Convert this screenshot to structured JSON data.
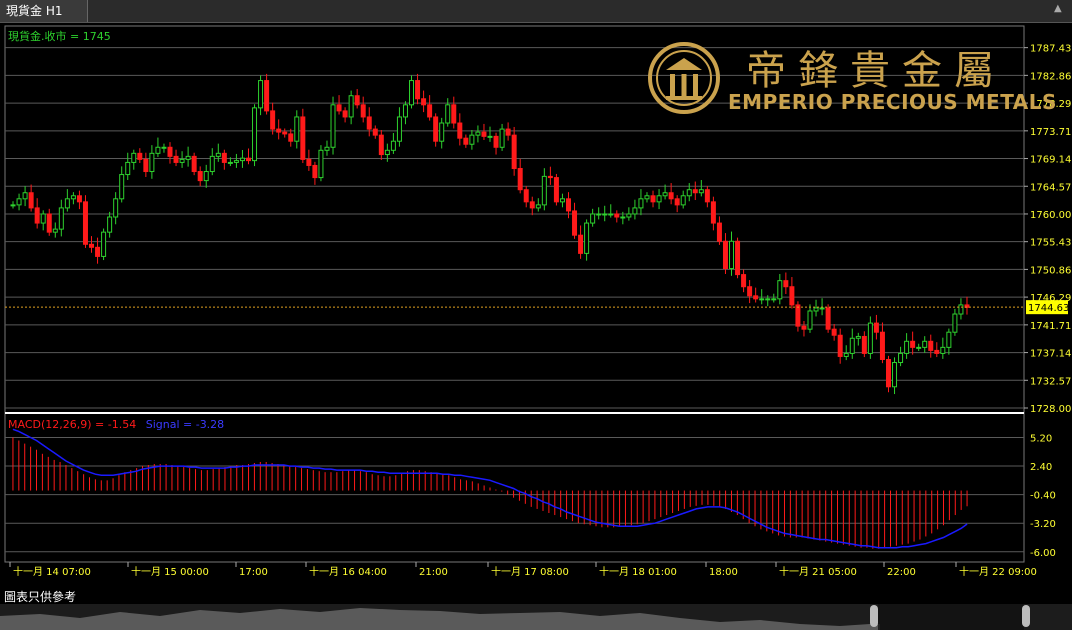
{
  "tab": {
    "label": "現貨金 H1"
  },
  "price_pane": {
    "legend": "現貨金.收市 = 1745"
  },
  "macd_pane": {
    "legend_macd": "MACD(12,26,9) = -1.54",
    "legend_signal": "Signal = -3.28"
  },
  "logo": {
    "chinese": "帝鋒貴金屬",
    "english": "EMPERIO PRECIOUS METALS"
  },
  "footer": {
    "note": "圖表只供參考"
  },
  "colors": {
    "up": "#2ed12e",
    "down": "#ff1a1a",
    "signal": "#1a1aff",
    "grid": "#5a5a5a",
    "axis_text": "#ffff33",
    "last_price_bg": "#ffff00",
    "gold": "#caa24d"
  },
  "chart_data": [
    {
      "type": "candlestick",
      "title": "現貨金 H1",
      "series_label": "現貨金.收市 = 1745",
      "ylim": [
        1728.0,
        1791.0
      ],
      "yticks": [
        1787.43,
        1782.86,
        1778.29,
        1773.71,
        1769.14,
        1764.57,
        1760.0,
        1755.43,
        1750.86,
        1746.29,
        1741.71,
        1737.14,
        1732.57,
        1728.0
      ],
      "last_price": 1744.63,
      "xticks": [
        "十一月 14 07:00",
        "十一月 15 00:00",
        "17:00",
        "十一月 16 04:00",
        "21:00",
        "十一月 17 08:00",
        "十一月 18 01:00",
        "18:00",
        "十一月 21 05:00",
        "22:00",
        "十一月 22 09:00"
      ],
      "closes": [
        1761.5,
        1762.5,
        1763.5,
        1761,
        1758.5,
        1760,
        1757,
        1757.5,
        1761,
        1762.5,
        1763,
        1762,
        1755,
        1754.5,
        1753,
        1757,
        1759.5,
        1762.5,
        1766.5,
        1768.5,
        1770,
        1769,
        1767,
        1770,
        1771,
        1771,
        1769.5,
        1768.5,
        1769,
        1769.5,
        1767,
        1765.5,
        1767,
        1769.5,
        1770,
        1768.5,
        1768.5,
        1768.8,
        1769.2,
        1768.8,
        1777.5,
        1782,
        1777,
        1774,
        1773.5,
        1773.2,
        1772,
        1776,
        1769,
        1768,
        1766,
        1770.5,
        1771,
        1778,
        1777,
        1776,
        1779.5,
        1778,
        1776,
        1774,
        1773,
        1769.8,
        1770.5,
        1772,
        1776,
        1778,
        1782,
        1779,
        1778,
        1776,
        1772,
        1775,
        1778,
        1775,
        1772.5,
        1771.5,
        1773,
        1773.5,
        1772.8,
        1772.8,
        1771,
        1774,
        1773,
        1767.5,
        1764,
        1762,
        1761,
        1761.5,
        1766.2,
        1766,
        1762,
        1762.5,
        1760.5,
        1756.5,
        1753.5,
        1758.5,
        1760,
        1760,
        1760,
        1760,
        1759.5,
        1759.5,
        1760,
        1761,
        1762.5,
        1763,
        1762,
        1763,
        1763.5,
        1762.5,
        1761.5,
        1763,
        1764,
        1763.5,
        1764,
        1762,
        1758.5,
        1755.5,
        1751,
        1755.5,
        1750,
        1748,
        1746.5,
        1746,
        1746,
        1746,
        1746,
        1749,
        1748,
        1745,
        1741.5,
        1741,
        1744,
        1744.5,
        1744.5,
        1741,
        1740,
        1736.5,
        1737,
        1739.5,
        1739.8,
        1737,
        1742,
        1740.5,
        1736,
        1731.5,
        1735.5,
        1737,
        1739,
        1738,
        1738,
        1739,
        1737.5,
        1737,
        1738,
        1740.5,
        1743.5,
        1745,
        1744.6
      ],
      "opens": [
        1761.5,
        1761.5,
        1762.5,
        1763.5,
        1761,
        1758.5,
        1760,
        1757,
        1757.5,
        1761,
        1762.5,
        1763,
        1762,
        1755,
        1754.5,
        1753,
        1757,
        1759.5,
        1762.5,
        1766.5,
        1768.5,
        1770,
        1769,
        1767,
        1770,
        1771,
        1771,
        1769.5,
        1768.5,
        1769,
        1769.5,
        1767,
        1765.5,
        1767,
        1769.5,
        1770,
        1768.5,
        1768.5,
        1768.8,
        1769.2,
        1768.8,
        1777.5,
        1782,
        1777,
        1774,
        1773.5,
        1773.2,
        1772,
        1776,
        1769,
        1768,
        1766,
        1770.5,
        1771,
        1778,
        1777,
        1776,
        1779.5,
        1778,
        1776,
        1774,
        1773,
        1769.8,
        1770.5,
        1772,
        1776,
        1778,
        1782,
        1779,
        1778,
        1776,
        1772,
        1775,
        1778,
        1775,
        1772.5,
        1771.5,
        1773,
        1773.5,
        1772.8,
        1772.8,
        1771,
        1774,
        1773,
        1767.5,
        1764,
        1762,
        1761,
        1761.5,
        1766.2,
        1766,
        1762,
        1762.5,
        1760.5,
        1756.5,
        1753.5,
        1758.5,
        1760,
        1760,
        1760,
        1760,
        1759.5,
        1759.5,
        1760,
        1761,
        1762.5,
        1763,
        1762,
        1763,
        1763.5,
        1762.5,
        1761.5,
        1763,
        1764,
        1763.5,
        1764,
        1762,
        1758.5,
        1755.5,
        1751,
        1755.5,
        1750,
        1748,
        1746.5,
        1746,
        1746,
        1746,
        1746,
        1749,
        1748,
        1745,
        1741.5,
        1741,
        1744,
        1744.5,
        1744.5,
        1741,
        1740,
        1736.5,
        1737,
        1739.5,
        1739.8,
        1737,
        1742,
        1740.5,
        1736,
        1731.5,
        1735.5,
        1737,
        1739,
        1738,
        1738,
        1739,
        1737.5,
        1737,
        1738,
        1740.5,
        1743.5,
        1745
      ]
    },
    {
      "type": "bar+line",
      "title": "MACD(12,26,9)",
      "ylim": [
        -7.0,
        7.5
      ],
      "yticks": [
        5.2,
        2.4,
        -0.4,
        -3.2,
        -6.0
      ],
      "macd": [
        5.2,
        4.9,
        4.6,
        4.3,
        4.0,
        3.6,
        3.3,
        3.0,
        2.8,
        2.5,
        2.2,
        1.9,
        1.6,
        1.3,
        1.1,
        1.0,
        1.0,
        1.2,
        1.5,
        1.8,
        2.0,
        2.2,
        2.4,
        2.5,
        2.6,
        2.6,
        2.6,
        2.5,
        2.4,
        2.3,
        2.2,
        2.1,
        2.0,
        2.0,
        2.1,
        2.2,
        2.3,
        2.4,
        2.5,
        2.5,
        2.6,
        2.7,
        2.8,
        2.8,
        2.7,
        2.6,
        2.5,
        2.4,
        2.3,
        2.2,
        2.1,
        2.0,
        1.9,
        1.8,
        1.8,
        1.8,
        1.9,
        2.0,
        2.0,
        1.9,
        1.8,
        1.6,
        1.5,
        1.4,
        1.4,
        1.5,
        1.7,
        1.9,
        2.0,
        2.0,
        1.9,
        1.8,
        1.7,
        1.6,
        1.5,
        1.3,
        1.1,
        1.0,
        0.9,
        0.7,
        0.5,
        0.3,
        0.1,
        -0.1,
        -0.4,
        -0.7,
        -1.0,
        -1.3,
        -1.6,
        -1.8,
        -2.0,
        -2.2,
        -2.4,
        -2.6,
        -2.8,
        -3.0,
        -3.2,
        -3.3,
        -3.4,
        -3.5,
        -3.6,
        -3.6,
        -3.6,
        -3.5,
        -3.5,
        -3.4,
        -3.3,
        -3.2,
        -3.0,
        -2.8,
        -2.6,
        -2.4,
        -2.2,
        -2.0,
        -1.8,
        -1.6,
        -1.5,
        -1.4,
        -1.4,
        -1.5,
        -1.6,
        -1.8,
        -2.1,
        -2.4,
        -2.8,
        -3.2,
        -3.5,
        -3.8,
        -4.0,
        -4.2,
        -4.4,
        -4.5,
        -4.6,
        -4.6,
        -4.6,
        -4.7,
        -4.8,
        -4.9,
        -5.0,
        -5.1,
        -5.2,
        -5.3,
        -5.4,
        -5.5,
        -5.6,
        -5.6,
        -5.7,
        -5.7,
        -5.6,
        -5.5,
        -5.4,
        -5.3,
        -5.2,
        -5.0,
        -4.8,
        -4.5,
        -4.2,
        -3.8,
        -3.4,
        -2.9,
        -2.4,
        -1.9,
        -1.54
      ],
      "signal": [
        6.0,
        5.8,
        5.5,
        5.2,
        4.9,
        4.5,
        4.1,
        3.7,
        3.3,
        2.9,
        2.6,
        2.3,
        2.0,
        1.8,
        1.6,
        1.5,
        1.5,
        1.5,
        1.6,
        1.7,
        1.8,
        1.9,
        2.1,
        2.2,
        2.3,
        2.4,
        2.4,
        2.4,
        2.4,
        2.4,
        2.3,
        2.3,
        2.2,
        2.2,
        2.2,
        2.2,
        2.2,
        2.3,
        2.3,
        2.4,
        2.4,
        2.5,
        2.5,
        2.5,
        2.5,
        2.5,
        2.5,
        2.4,
        2.4,
        2.3,
        2.3,
        2.2,
        2.2,
        2.1,
        2.1,
        2.0,
        2.0,
        2.0,
        2.0,
        2.0,
        1.9,
        1.9,
        1.8,
        1.8,
        1.7,
        1.7,
        1.7,
        1.7,
        1.7,
        1.7,
        1.7,
        1.7,
        1.7,
        1.6,
        1.6,
        1.5,
        1.5,
        1.4,
        1.3,
        1.2,
        1.1,
        1.0,
        0.8,
        0.6,
        0.4,
        0.2,
        -0.1,
        -0.3,
        -0.6,
        -0.8,
        -1.1,
        -1.3,
        -1.6,
        -1.8,
        -2.1,
        -2.3,
        -2.5,
        -2.7,
        -2.9,
        -3.1,
        -3.2,
        -3.3,
        -3.4,
        -3.5,
        -3.5,
        -3.5,
        -3.5,
        -3.4,
        -3.3,
        -3.2,
        -3.0,
        -2.8,
        -2.6,
        -2.4,
        -2.2,
        -2.0,
        -1.8,
        -1.7,
        -1.6,
        -1.6,
        -1.6,
        -1.7,
        -1.9,
        -2.1,
        -2.4,
        -2.7,
        -3.0,
        -3.3,
        -3.6,
        -3.8,
        -4.0,
        -4.2,
        -4.3,
        -4.4,
        -4.5,
        -4.6,
        -4.7,
        -4.8,
        -4.8,
        -4.9,
        -5.0,
        -5.1,
        -5.2,
        -5.3,
        -5.4,
        -5.4,
        -5.5,
        -5.6,
        -5.6,
        -5.6,
        -5.6,
        -5.5,
        -5.5,
        -5.4,
        -5.3,
        -5.2,
        -5.0,
        -4.8,
        -4.6,
        -4.3,
        -4.0,
        -3.7,
        -3.28
      ]
    }
  ]
}
